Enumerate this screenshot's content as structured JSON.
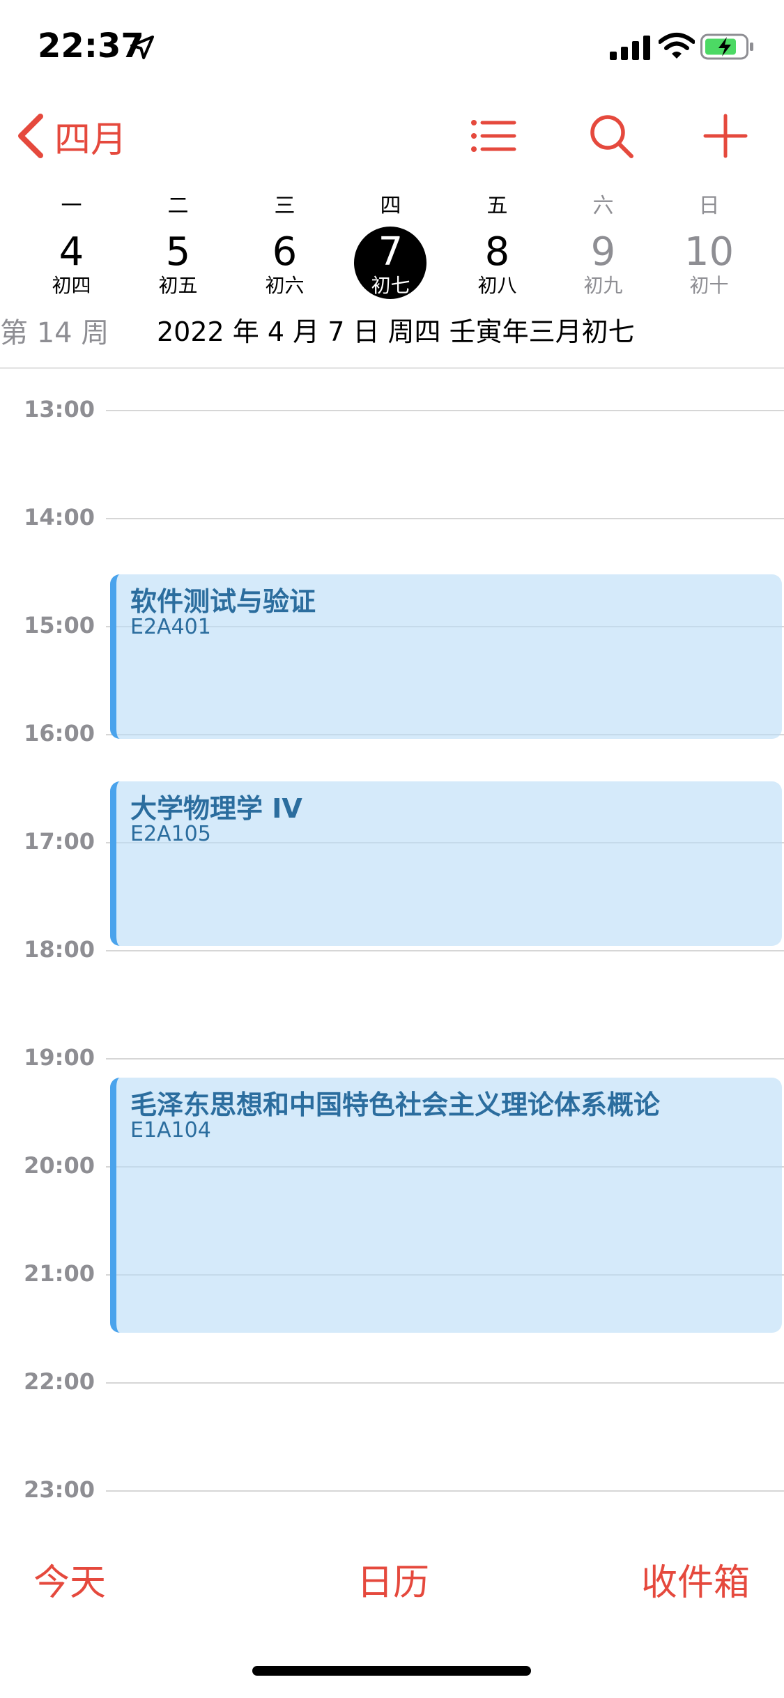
{
  "status_bar": {
    "time": "22:37"
  },
  "header": {
    "back_label": "四月"
  },
  "week": {
    "days": [
      {
        "weekday": "一",
        "date": "4",
        "lunar": "初四"
      },
      {
        "weekday": "二",
        "date": "5",
        "lunar": "初五"
      },
      {
        "weekday": "三",
        "date": "6",
        "lunar": "初六"
      },
      {
        "weekday": "四",
        "date": "7",
        "lunar": "初七",
        "selected": true
      },
      {
        "weekday": "五",
        "date": "8",
        "lunar": "初八"
      },
      {
        "weekday": "六",
        "date": "9",
        "lunar": "初九",
        "weekend": true
      },
      {
        "weekday": "日",
        "date": "10",
        "lunar": "初十",
        "weekend": true
      }
    ],
    "week_number": "第 14 周",
    "date_line": "2022 年 4 月 7 日  周四    壬寅年三月初七"
  },
  "timeline": {
    "hours": [
      "13:00",
      "14:00",
      "15:00",
      "16:00",
      "17:00",
      "18:00",
      "19:00",
      "20:00",
      "21:00",
      "22:00",
      "23:00"
    ],
    "events": [
      {
        "title": "软件测试与验证",
        "location": "E2A401"
      },
      {
        "title": "大学物理学 IV",
        "location": "E2A105"
      },
      {
        "title": "毛泽东思想和中国特色社会主义理论体系概论",
        "location": "E1A104"
      }
    ]
  },
  "toolbar": {
    "today": "今天",
    "calendars": "日历",
    "inbox": "收件箱"
  },
  "colors": {
    "accent": "#e5493d",
    "event_fill": "#d6eaf9",
    "event_bar": "#4aa3ec",
    "event_text": "#2b6d9e"
  }
}
